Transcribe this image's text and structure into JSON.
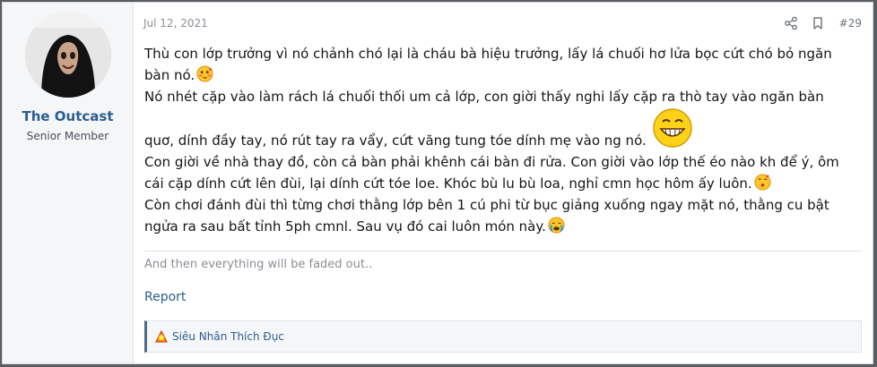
{
  "author": {
    "name": "The Outcast",
    "title": "Senior Member"
  },
  "meta": {
    "date": "Jul 12, 2021",
    "post_number": "#29",
    "share_icon": "share-icon",
    "bookmark_icon": "bookmark-icon"
  },
  "content": {
    "line1": "Thù con lớp trưởng vì nó chảnh chó lại là cháu bà hiệu trưởng, lấy lá chuối hơ lửa bọc cứt chó bỏ ngăn bàn nó.",
    "line2": "Nó nhét cặp vào làm rách lá chuối thối um cả lớp, con giời thấy nghi lấy cặp ra thò tay vào ngăn bàn quơ, dính đầy tay, nó rút tay ra vẩy, cứt văng tung tóe dính mẹ vào ng nó.",
    "line3": "Con giời về nhà thay đồ, còn cả bàn phải khênh cái bàn đi rửa. Con giời vào lớp thế éo nào kh để ý, ôm cái cặp dính cứt lên đùi, lại dính cứt tóe loe. Khóc bù lu bù loa, nghỉ cmn học hôm ấy luôn.",
    "line4": "Còn chơi đánh đùi thì từng chơi thằng lớp bên 1 cú phi từ bục giảng xuống ngay mặt nó, thằng cu bật ngửa ra sau bất tỉnh 5ph cmnl. Sau vụ đó cai luôn món này."
  },
  "signature": "And then everything will be faded out..",
  "report_label": "Report",
  "reactions": {
    "text": "Siêu Nhân Thích Đục"
  },
  "colors": {
    "link": "#2c5e8f",
    "muted": "#8a8f96",
    "sidebar_bg": "#f4f6f8",
    "page_bg": "#5a5d60"
  }
}
